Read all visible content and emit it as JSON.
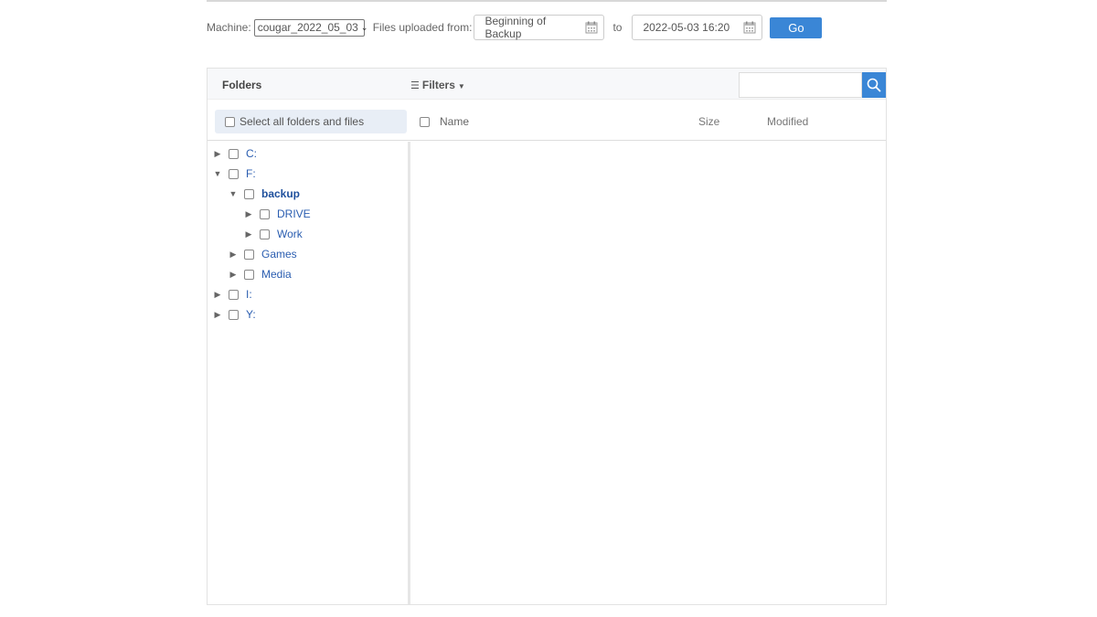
{
  "toolbar": {
    "machine_label": "Machine:",
    "machine_value": "cougar_2022_05_03",
    "from_label": "Files uploaded from:",
    "from_value": "Beginning of Backup",
    "to_label": "to",
    "to_value": "2022-05-03 16:20",
    "go_label": "Go"
  },
  "panel": {
    "folders_title": "Folders",
    "filters_label": "Filters",
    "search_placeholder": "",
    "select_all_label": "Select all folders and files",
    "columns": {
      "name": "Name",
      "size": "Size",
      "modified": "Modified"
    }
  },
  "tree": [
    {
      "label": "C:",
      "level": 0,
      "expanded": false
    },
    {
      "label": "F:",
      "level": 0,
      "expanded": true
    },
    {
      "label": "backup",
      "level": 1,
      "expanded": true,
      "bold": true
    },
    {
      "label": "DRIVE",
      "level": 2,
      "expanded": false
    },
    {
      "label": "Work",
      "level": 2,
      "expanded": false
    },
    {
      "label": "Games",
      "level": 1,
      "expanded": false
    },
    {
      "label": "Media",
      "level": 1,
      "expanded": false
    },
    {
      "label": "I:",
      "level": 0,
      "expanded": false
    },
    {
      "label": "Y:",
      "level": 0,
      "expanded": false
    }
  ],
  "colors": {
    "accent": "#3a86d6",
    "link": "#2a5db0"
  }
}
